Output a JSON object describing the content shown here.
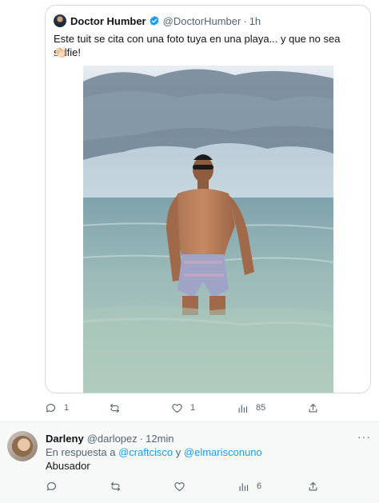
{
  "quoted_tweet": {
    "author_name": "Doctor Humber",
    "author_handle": "@DoctorHumber",
    "separator": "·",
    "time": "1h",
    "text": "Este tuit se cita con una foto tuya en una playa... y que no sea selfie!",
    "emoji": "👏🏻",
    "verified_color": "#1d9bf0",
    "photo_icon": "beach-photo"
  },
  "quoted_actions": {
    "replies": "1",
    "retweets": "",
    "likes": "1",
    "views": "85"
  },
  "reply_tweet": {
    "author_name": "Darleny",
    "author_handle": "@darlopez",
    "separator": "·",
    "time": "12min",
    "replying_prefix": "En respuesta a ",
    "mention_1": "@craftcisco",
    "replying_join": " y ",
    "mention_2": "@elmarisconuno",
    "text": "Abusador",
    "more_label": "···"
  },
  "reply_actions": {
    "replies": "",
    "retweets": "",
    "likes": "",
    "views": "6"
  },
  "colors": {
    "link": "#1d9bf0",
    "muted": "#536471",
    "text": "#0f1419",
    "reply_bg": "#f7f9f9"
  }
}
